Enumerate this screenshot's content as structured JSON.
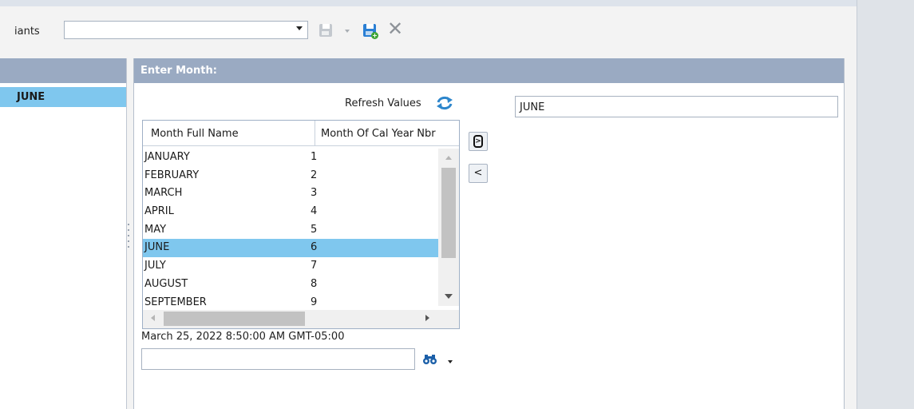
{
  "toolbar": {
    "variants_label": "iants",
    "variants_value": ""
  },
  "left_panel": {
    "selected_item": "JUNE"
  },
  "month_panel": {
    "header": "Enter Month:",
    "refresh_label": "Refresh Values",
    "selected_values_field": "JUNE",
    "move_all_glyph": ">",
    "move_one_label": "<",
    "timestamp": "March 25, 2022 8:50:00 AM GMT-05:00",
    "search_value": ""
  },
  "grid": {
    "columns": [
      "Month Full Name",
      "Month Of Cal Year Nbr"
    ],
    "rows": [
      {
        "name": "JANUARY",
        "nbr": "1"
      },
      {
        "name": "FEBRUARY",
        "nbr": "2"
      },
      {
        "name": "MARCH",
        "nbr": "3"
      },
      {
        "name": "APRIL",
        "nbr": "4"
      },
      {
        "name": "MAY",
        "nbr": "5"
      },
      {
        "name": "JUNE",
        "nbr": "6"
      },
      {
        "name": "JULY",
        "nbr": "7"
      },
      {
        "name": "AUGUST",
        "nbr": "8"
      },
      {
        "name": "SEPTEMBER",
        "nbr": "9"
      }
    ],
    "selected_row": 5
  },
  "colors": {
    "header_bg": "#9aaac2",
    "selection": "#7fc7ee",
    "save_icon": "#2a7fd4",
    "save_disabled": "#c3c8ce"
  },
  "icons": [
    "dropdown-arrow-icon",
    "save-disabled-icon",
    "save-as-icon",
    "close-icon",
    "refresh-icon",
    "binoculars-icon"
  ]
}
